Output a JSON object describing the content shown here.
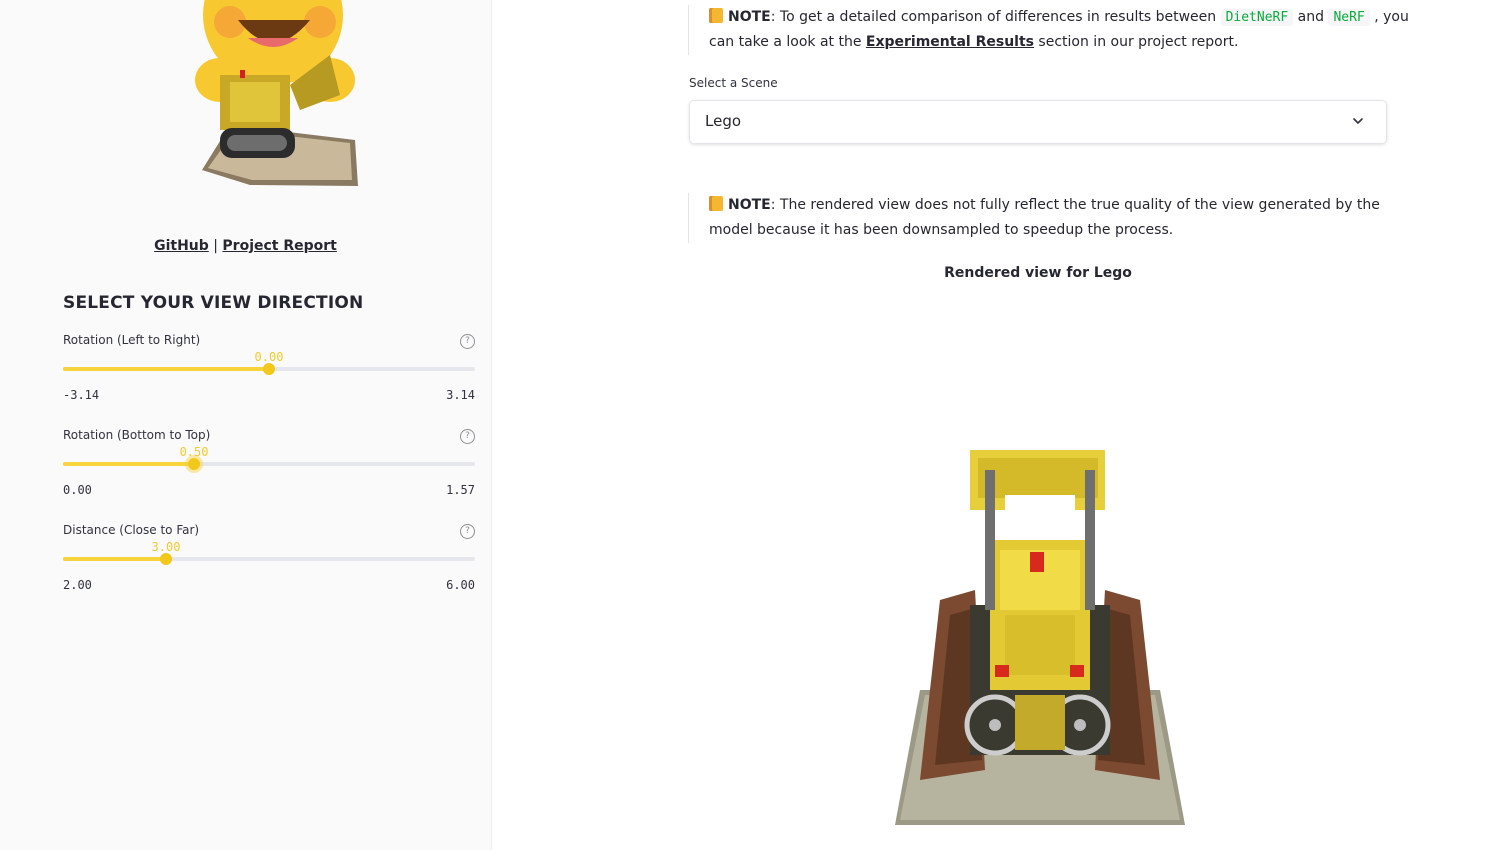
{
  "sidebar": {
    "links": {
      "github": "GitHub",
      "separator": "|",
      "report": "Project Report"
    },
    "title": "SELECT YOUR VIEW DIRECTION",
    "sliders": [
      {
        "label": "Rotation (Left to Right)",
        "value": "0.00",
        "min": "-3.14",
        "max": "3.14",
        "fraction": 0.5
      },
      {
        "label": "Rotation (Bottom to Top)",
        "value": "0.50",
        "min": "0.00",
        "max": "1.57",
        "fraction": 0.318
      },
      {
        "label": "Distance (Close to Far)",
        "value": "3.00",
        "min": "2.00",
        "max": "6.00",
        "fraction": 0.25
      }
    ],
    "help_symbol": "?"
  },
  "main": {
    "note1": {
      "label": "NOTE",
      "text_a": ": To get a detailed comparison of differences in results between ",
      "code_a": "DietNeRF",
      "text_b": " and ",
      "code_b": "NeRF",
      "text_c": " , you can take a look at the ",
      "link": "Experimental Results",
      "text_d": " section in our project report."
    },
    "select_label": "Select a Scene",
    "select_value": "Lego",
    "note2": {
      "label": "NOTE",
      "text": ": The rendered view does not fully reflect the true quality of the view generated by the model because it has been downsampled to speedup the process."
    },
    "caption": "Rendered view for Lego"
  },
  "colors": {
    "accent": "#f9d33b",
    "code": "#09ab3b",
    "text": "#262730"
  }
}
